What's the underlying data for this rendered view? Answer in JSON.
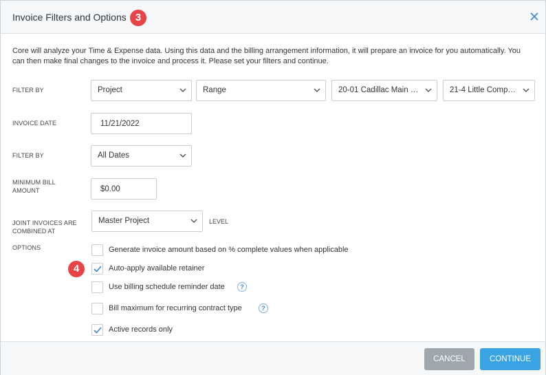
{
  "header": {
    "title": "Invoice Filters and Options",
    "step_badge": "3"
  },
  "intro": "Core will analyze your Time & Expense data. Using this data and the billing arrangement information, it will prepare an invoice for you automatically. You can then make final changes to the invoice and process it. Please set your filters and continue.",
  "filter_by_1": {
    "label": "FILTER BY",
    "type_value": "Project",
    "mode_value": "Range",
    "range_start": "20-01 Cadillac Main B...",
    "range_end": "21-4 Little Compa..."
  },
  "invoice_date": {
    "label": "INVOICE DATE",
    "value": "11/21/2022"
  },
  "filter_by_2": {
    "label": "FILTER BY",
    "value": "All Dates"
  },
  "minimum_bill": {
    "label_line1": "MINIMUM BILL",
    "label_line2": "AMOUNT",
    "value": "$0.00"
  },
  "joint_invoices": {
    "label_line1": "JOINT INVOICES ARE",
    "label_line2": "COMBINED AT",
    "value": "Master Project",
    "suffix": "LEVEL"
  },
  "options": {
    "label": "OPTIONS",
    "step_badge": "4",
    "items": [
      {
        "label": "Generate invoice amount based on % complete values when applicable",
        "checked": false
      },
      {
        "label": "Auto-apply available retainer",
        "checked": true
      },
      {
        "label": "Use billing schedule reminder date",
        "checked": false,
        "help": "?"
      },
      {
        "label": "Bill maximum for recurring contract type",
        "checked": false,
        "help": "?"
      },
      {
        "label": "Active records only",
        "checked": true
      }
    ]
  },
  "footer": {
    "cancel_label": "CANCEL",
    "continue_label": "CONTINUE"
  },
  "colors": {
    "accent": "#3aa3e3",
    "badge": "#e84448",
    "cancel": "#9fa6ac",
    "check": "#3a86d1"
  }
}
